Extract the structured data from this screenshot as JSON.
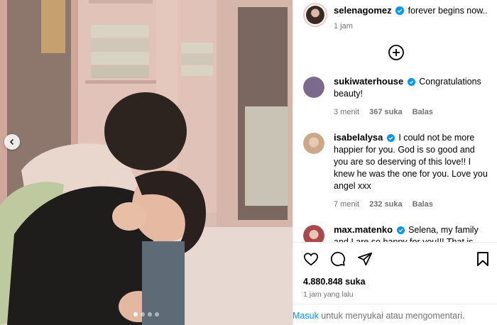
{
  "post": {
    "author": "selenagomez",
    "caption": "forever begins now..",
    "time": "1 jam",
    "likes": "4.880.848 suka",
    "posted_ago": "1 jam yang lalu",
    "carousel": {
      "slide_count": 4,
      "active_index": 0
    }
  },
  "comments": [
    {
      "user": "sukiwaterhouse",
      "text": "Congratulations beauty!",
      "time": "3 menit",
      "likes": "367 suka",
      "reply": "Balas",
      "avatar_color": "#7b6a8c"
    },
    {
      "user": "isabelalysa",
      "text": "I could not be more happier for you. God is so good and you are so deserving of this love!! I knew he was the one for you. Love you angel xxx",
      "time": "7 menit",
      "likes": "232 suka",
      "reply": "Balas",
      "avatar_color": "#c9a98a"
    },
    {
      "user": "max.matenko",
      "text": "Selena, my family and I are so happy for you!!! That is amazing news!!!!! 💗🥰💞✨🙏",
      "avatar_color": "#a8494f"
    }
  ],
  "footer": {
    "login_link": "Masuk",
    "login_rest": " untuk menyukai atau mengomentari."
  },
  "icons": [
    "verified-icon",
    "plus-circle-icon",
    "heart-icon",
    "comment-icon",
    "share-icon",
    "bookmark-icon",
    "chevron-left-icon"
  ],
  "colors": {
    "verified": "#0095f6",
    "link": "#0095f6",
    "muted": "#737373"
  }
}
